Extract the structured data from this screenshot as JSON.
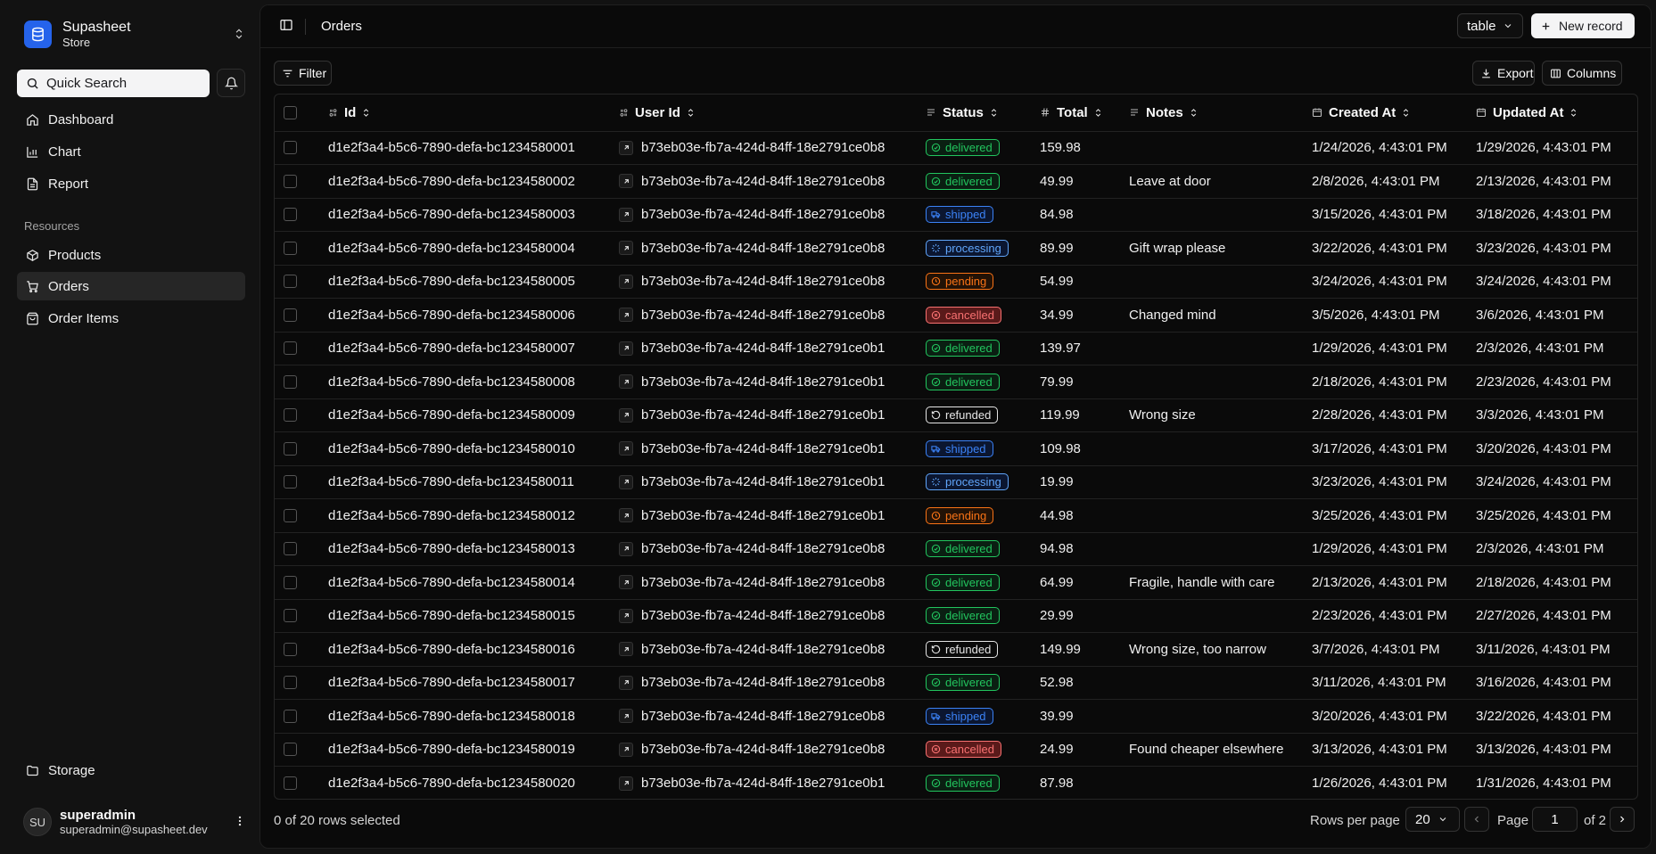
{
  "brand": {
    "name": "Supasheet",
    "subtitle": "Store"
  },
  "search": {
    "label": "Quick Search"
  },
  "nav": {
    "dashboard": "Dashboard",
    "chart": "Chart",
    "report": "Report",
    "resources_label": "Resources",
    "products": "Products",
    "orders": "Orders",
    "order_items": "Order Items",
    "storage": "Storage"
  },
  "user": {
    "initials": "SU",
    "name": "superadmin",
    "email": "superadmin@supasheet.dev"
  },
  "header": {
    "title": "Orders",
    "view_select": "table",
    "new_record": "New record"
  },
  "toolbar": {
    "filter": "Filter",
    "export": "Export",
    "columns": "Columns"
  },
  "table": {
    "headers": {
      "id": "Id",
      "user_id": "User Id",
      "status": "Status",
      "total": "Total",
      "notes": "Notes",
      "created_at": "Created At",
      "updated_at": "Updated At"
    },
    "rows": [
      {
        "id": "d1e2f3a4-b5c6-7890-defa-bc1234580001",
        "user_id": "b73eb03e-fb7a-424d-84ff-18e2791ce0b8",
        "status": "delivered",
        "total": "159.98",
        "notes": "",
        "created_at": "1/24/2026, 4:43:01 PM",
        "updated_at": "1/29/2026, 4:43:01 PM"
      },
      {
        "id": "d1e2f3a4-b5c6-7890-defa-bc1234580002",
        "user_id": "b73eb03e-fb7a-424d-84ff-18e2791ce0b8",
        "status": "delivered",
        "total": "49.99",
        "notes": "Leave at door",
        "created_at": "2/8/2026, 4:43:01 PM",
        "updated_at": "2/13/2026, 4:43:01 PM"
      },
      {
        "id": "d1e2f3a4-b5c6-7890-defa-bc1234580003",
        "user_id": "b73eb03e-fb7a-424d-84ff-18e2791ce0b8",
        "status": "shipped",
        "total": "84.98",
        "notes": "",
        "created_at": "3/15/2026, 4:43:01 PM",
        "updated_at": "3/18/2026, 4:43:01 PM"
      },
      {
        "id": "d1e2f3a4-b5c6-7890-defa-bc1234580004",
        "user_id": "b73eb03e-fb7a-424d-84ff-18e2791ce0b8",
        "status": "processing",
        "total": "89.99",
        "notes": "Gift wrap please",
        "created_at": "3/22/2026, 4:43:01 PM",
        "updated_at": "3/23/2026, 4:43:01 PM"
      },
      {
        "id": "d1e2f3a4-b5c6-7890-defa-bc1234580005",
        "user_id": "b73eb03e-fb7a-424d-84ff-18e2791ce0b8",
        "status": "pending",
        "total": "54.99",
        "notes": "",
        "created_at": "3/24/2026, 4:43:01 PM",
        "updated_at": "3/24/2026, 4:43:01 PM"
      },
      {
        "id": "d1e2f3a4-b5c6-7890-defa-bc1234580006",
        "user_id": "b73eb03e-fb7a-424d-84ff-18e2791ce0b8",
        "status": "cancelled",
        "total": "34.99",
        "notes": "Changed mind",
        "created_at": "3/5/2026, 4:43:01 PM",
        "updated_at": "3/6/2026, 4:43:01 PM"
      },
      {
        "id": "d1e2f3a4-b5c6-7890-defa-bc1234580007",
        "user_id": "b73eb03e-fb7a-424d-84ff-18e2791ce0b1",
        "status": "delivered",
        "total": "139.97",
        "notes": "",
        "created_at": "1/29/2026, 4:43:01 PM",
        "updated_at": "2/3/2026, 4:43:01 PM"
      },
      {
        "id": "d1e2f3a4-b5c6-7890-defa-bc1234580008",
        "user_id": "b73eb03e-fb7a-424d-84ff-18e2791ce0b1",
        "status": "delivered",
        "total": "79.99",
        "notes": "",
        "created_at": "2/18/2026, 4:43:01 PM",
        "updated_at": "2/23/2026, 4:43:01 PM"
      },
      {
        "id": "d1e2f3a4-b5c6-7890-defa-bc1234580009",
        "user_id": "b73eb03e-fb7a-424d-84ff-18e2791ce0b1",
        "status": "refunded",
        "total": "119.99",
        "notes": "Wrong size",
        "created_at": "2/28/2026, 4:43:01 PM",
        "updated_at": "3/3/2026, 4:43:01 PM"
      },
      {
        "id": "d1e2f3a4-b5c6-7890-defa-bc1234580010",
        "user_id": "b73eb03e-fb7a-424d-84ff-18e2791ce0b1",
        "status": "shipped",
        "total": "109.98",
        "notes": "",
        "created_at": "3/17/2026, 4:43:01 PM",
        "updated_at": "3/20/2026, 4:43:01 PM"
      },
      {
        "id": "d1e2f3a4-b5c6-7890-defa-bc1234580011",
        "user_id": "b73eb03e-fb7a-424d-84ff-18e2791ce0b1",
        "status": "processing",
        "total": "19.99",
        "notes": "",
        "created_at": "3/23/2026, 4:43:01 PM",
        "updated_at": "3/24/2026, 4:43:01 PM"
      },
      {
        "id": "d1e2f3a4-b5c6-7890-defa-bc1234580012",
        "user_id": "b73eb03e-fb7a-424d-84ff-18e2791ce0b1",
        "status": "pending",
        "total": "44.98",
        "notes": "",
        "created_at": "3/25/2026, 4:43:01 PM",
        "updated_at": "3/25/2026, 4:43:01 PM"
      },
      {
        "id": "d1e2f3a4-b5c6-7890-defa-bc1234580013",
        "user_id": "b73eb03e-fb7a-424d-84ff-18e2791ce0b8",
        "status": "delivered",
        "total": "94.98",
        "notes": "",
        "created_at": "1/29/2026, 4:43:01 PM",
        "updated_at": "2/3/2026, 4:43:01 PM"
      },
      {
        "id": "d1e2f3a4-b5c6-7890-defa-bc1234580014",
        "user_id": "b73eb03e-fb7a-424d-84ff-18e2791ce0b8",
        "status": "delivered",
        "total": "64.99",
        "notes": "Fragile, handle with care",
        "created_at": "2/13/2026, 4:43:01 PM",
        "updated_at": "2/18/2026, 4:43:01 PM"
      },
      {
        "id": "d1e2f3a4-b5c6-7890-defa-bc1234580015",
        "user_id": "b73eb03e-fb7a-424d-84ff-18e2791ce0b8",
        "status": "delivered",
        "total": "29.99",
        "notes": "",
        "created_at": "2/23/2026, 4:43:01 PM",
        "updated_at": "2/27/2026, 4:43:01 PM"
      },
      {
        "id": "d1e2f3a4-b5c6-7890-defa-bc1234580016",
        "user_id": "b73eb03e-fb7a-424d-84ff-18e2791ce0b8",
        "status": "refunded",
        "total": "149.99",
        "notes": "Wrong size, too narrow",
        "created_at": "3/7/2026, 4:43:01 PM",
        "updated_at": "3/11/2026, 4:43:01 PM"
      },
      {
        "id": "d1e2f3a4-b5c6-7890-defa-bc1234580017",
        "user_id": "b73eb03e-fb7a-424d-84ff-18e2791ce0b8",
        "status": "delivered",
        "total": "52.98",
        "notes": "",
        "created_at": "3/11/2026, 4:43:01 PM",
        "updated_at": "3/16/2026, 4:43:01 PM"
      },
      {
        "id": "d1e2f3a4-b5c6-7890-defa-bc1234580018",
        "user_id": "b73eb03e-fb7a-424d-84ff-18e2791ce0b8",
        "status": "shipped",
        "total": "39.99",
        "notes": "",
        "created_at": "3/20/2026, 4:43:01 PM",
        "updated_at": "3/22/2026, 4:43:01 PM"
      },
      {
        "id": "d1e2f3a4-b5c6-7890-defa-bc1234580019",
        "user_id": "b73eb03e-fb7a-424d-84ff-18e2791ce0b8",
        "status": "cancelled",
        "total": "24.99",
        "notes": "Found cheaper elsewhere",
        "created_at": "3/13/2026, 4:43:01 PM",
        "updated_at": "3/13/2026, 4:43:01 PM"
      },
      {
        "id": "d1e2f3a4-b5c6-7890-defa-bc1234580020",
        "user_id": "b73eb03e-fb7a-424d-84ff-18e2791ce0b1",
        "status": "delivered",
        "total": "87.98",
        "notes": "",
        "created_at": "1/26/2026, 4:43:01 PM",
        "updated_at": "1/31/2026, 4:43:01 PM"
      }
    ]
  },
  "status_styles": {
    "delivered": {
      "color": "#22c55e",
      "bg": "#0a1f12",
      "icon": "check-circle-icon"
    },
    "shipped": {
      "color": "#3b82f6",
      "bg": "#0b1630",
      "icon": "truck-icon"
    },
    "processing": {
      "color": "#60a5fa",
      "bg": "#0b1630",
      "icon": "loader-icon"
    },
    "pending": {
      "color": "#f97316",
      "bg": "#221206",
      "icon": "clock-icon"
    },
    "cancelled": {
      "color": "#f87171",
      "bg": "#5a1a1a",
      "icon": "x-circle-icon"
    },
    "refunded": {
      "color": "#e5e5e5",
      "bg": "#0a0a0a",
      "icon": "rotate-ccw-icon"
    }
  },
  "footer": {
    "selected": "0 of 20 rows selected",
    "rows_per_page_label": "Rows per page",
    "rows_per_page": "20",
    "page_label": "Page",
    "page": "1",
    "of_pages": "of 2"
  }
}
